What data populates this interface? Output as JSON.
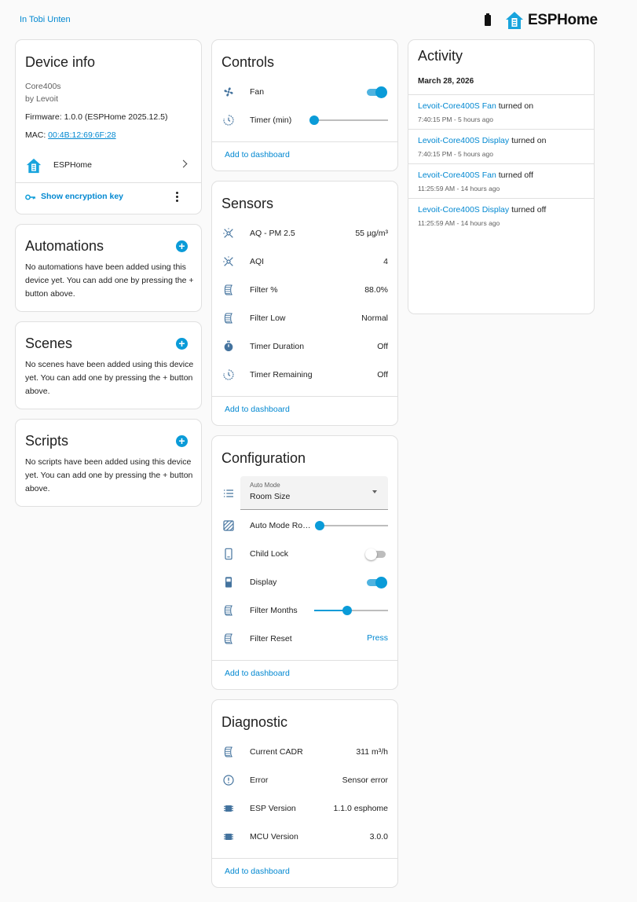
{
  "header": {
    "breadcrumb": "In Tobi Unten",
    "brand": "ESPHome"
  },
  "device_info": {
    "title": "Device info",
    "model": "Core400s",
    "manufacturer": "by Levoit",
    "firmware": "Firmware: 1.0.0 (ESPHome 2025.12.5)",
    "mac_label": "MAC: ",
    "mac": "00:4B:12:69:6F:28",
    "integration": "ESPHome",
    "encryption_label": "Show encryption key"
  },
  "automations": {
    "title": "Automations",
    "text": "No automations have been added using this device yet. You can add one by pressing the + button above."
  },
  "scenes": {
    "title": "Scenes",
    "text": "No scenes have been added using this device yet. You can add one by pressing the + button above."
  },
  "scripts": {
    "title": "Scripts",
    "text": "No scripts have been added using this device yet. You can add one by pressing the + button above."
  },
  "controls": {
    "title": "Controls",
    "fan_label": "Fan",
    "fan_on": true,
    "timer_label": "Timer (min)",
    "timer_level": 0,
    "add_label": "Add to dashboard"
  },
  "sensors": {
    "title": "Sensors",
    "items": [
      {
        "label": "AQ - PM 2.5",
        "value": "55 µg/m³",
        "icon": "air-quality-icon"
      },
      {
        "label": "AQI",
        "value": "4",
        "icon": "air-quality-icon"
      },
      {
        "label": "Filter %",
        "value": "88.0%",
        "icon": "air-filter-icon"
      },
      {
        "label": "Filter Low",
        "value": "Normal",
        "icon": "air-filter-icon"
      },
      {
        "label": "Timer Duration",
        "value": "Off",
        "icon": "timer-icon"
      },
      {
        "label": "Timer Remaining",
        "value": "Off",
        "icon": "timer-clock-icon"
      }
    ],
    "add_label": "Add to dashboard"
  },
  "configuration": {
    "title": "Configuration",
    "select_label": "Auto Mode",
    "select_value": "Room Size",
    "auto_room_label": "Auto Mode Ro…",
    "auto_room_level": 0,
    "child_lock_label": "Child Lock",
    "child_lock_on": false,
    "display_label": "Display",
    "display_on": true,
    "filter_months_label": "Filter Months",
    "filter_months_level": 0.45,
    "filter_reset_label": "Filter Reset",
    "press_label": "Press",
    "add_label": "Add to dashboard"
  },
  "diagnostic": {
    "title": "Diagnostic",
    "items": [
      {
        "label": "Current CADR",
        "value": "311 m³/h",
        "icon": "air-filter-icon"
      },
      {
        "label": "Error",
        "value": "Sensor error",
        "icon": "alert-circle-icon"
      },
      {
        "label": "ESP Version",
        "value": "1.1.0 esphome",
        "icon": "chip-icon"
      },
      {
        "label": "MCU Version",
        "value": "3.0.0",
        "icon": "chip-icon"
      }
    ],
    "add_label": "Add to dashboard"
  },
  "activity": {
    "title": "Activity",
    "date": "March 28, 2026",
    "items": [
      {
        "entity": "Levoit-Core400S Fan",
        "action": " turned on",
        "time": "7:40:15 PM - 5 hours ago"
      },
      {
        "entity": "Levoit-Core400S Display",
        "action": " turned on",
        "time": "7:40:15 PM - 5 hours ago"
      },
      {
        "entity": "Levoit-Core400S Fan",
        "action": " turned off",
        "time": "11:25:59 AM - 14 hours ago"
      },
      {
        "entity": "Levoit-Core400S Display",
        "action": " turned off",
        "time": "11:25:59 AM - 14 hours ago"
      }
    ]
  }
}
